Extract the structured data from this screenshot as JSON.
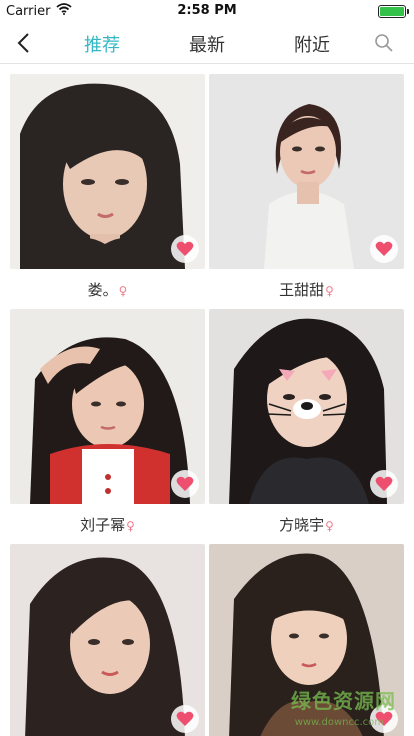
{
  "status_bar": {
    "carrier": "Carrier",
    "time": "2:58 PM"
  },
  "nav": {
    "tabs": [
      {
        "label": "推荐",
        "active": true
      },
      {
        "label": "最新",
        "active": false
      },
      {
        "label": "附近",
        "active": false
      }
    ]
  },
  "cards": [
    {
      "name": "娄。",
      "gender_symbol": "♀"
    },
    {
      "name": "王甜甜",
      "gender_symbol": "♀"
    },
    {
      "name": "刘子幂",
      "gender_symbol": "♀"
    },
    {
      "name": "方晓宇",
      "gender_symbol": "♀"
    },
    {
      "name": "",
      "gender_symbol": ""
    },
    {
      "name": "",
      "gender_symbol": ""
    }
  ],
  "watermark": {
    "text": "绿色资源网",
    "sub": "www.downcc.com"
  },
  "colors": {
    "accent": "#35b8c3",
    "heart": "#ef4f6e",
    "gender": "#ef7d8d",
    "battery": "#35c24a"
  }
}
